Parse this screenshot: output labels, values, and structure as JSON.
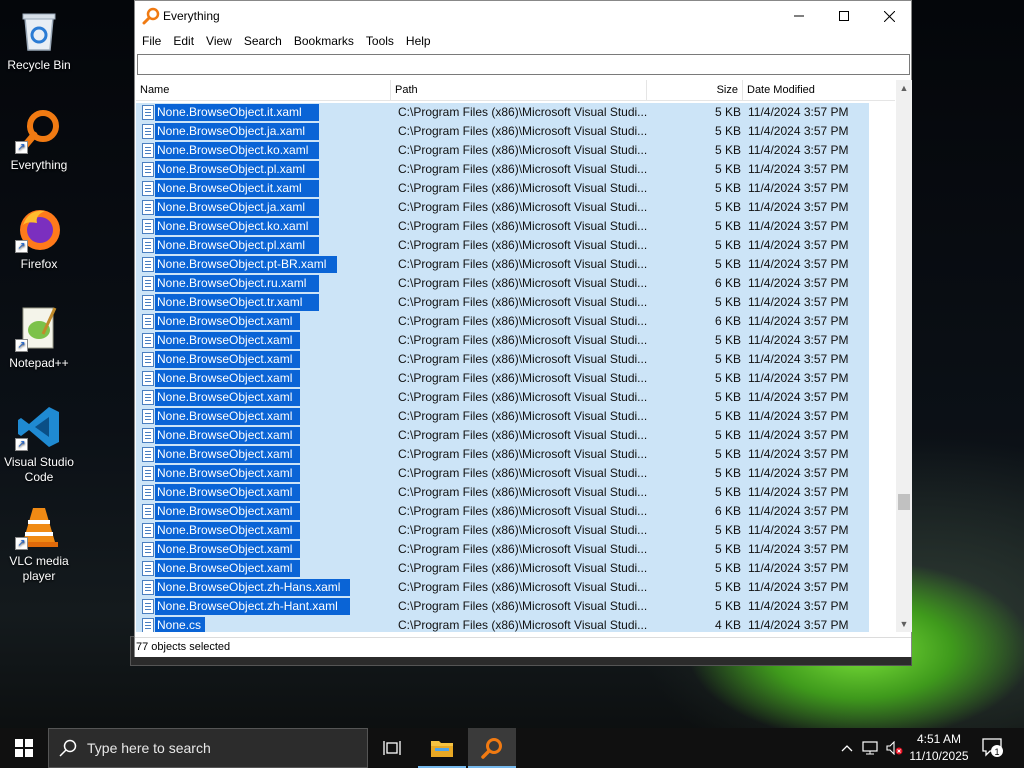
{
  "desktop": {
    "icons": [
      {
        "label": "Recycle Bin"
      },
      {
        "label": "Everything"
      },
      {
        "label": "Firefox"
      },
      {
        "label": "Notepad++"
      },
      {
        "label": "Visual Studio Code"
      },
      {
        "label": "VLC media player"
      }
    ]
  },
  "window": {
    "title": "Everything",
    "menu": [
      "File",
      "Edit",
      "View",
      "Search",
      "Bookmarks",
      "Tools",
      "Help"
    ],
    "search": {
      "value": "",
      "placeholder": ""
    },
    "columns": {
      "name": "Name",
      "path": "Path",
      "size": "Size",
      "date": "Date Modified"
    },
    "rows": [
      {
        "name": "None.BrowseObject.it.xaml",
        "path": "C:\\Program Files (x86)\\Microsoft Visual Studi...",
        "size": "5 KB",
        "date": "11/4/2024 3:57 PM"
      },
      {
        "name": "None.BrowseObject.ja.xaml",
        "path": "C:\\Program Files (x86)\\Microsoft Visual Studi...",
        "size": "5 KB",
        "date": "11/4/2024 3:57 PM"
      },
      {
        "name": "None.BrowseObject.ko.xaml",
        "path": "C:\\Program Files (x86)\\Microsoft Visual Studi...",
        "size": "5 KB",
        "date": "11/4/2024 3:57 PM"
      },
      {
        "name": "None.BrowseObject.pl.xaml",
        "path": "C:\\Program Files (x86)\\Microsoft Visual Studi...",
        "size": "5 KB",
        "date": "11/4/2024 3:57 PM"
      },
      {
        "name": "None.BrowseObject.it.xaml",
        "path": "C:\\Program Files (x86)\\Microsoft Visual Studi...",
        "size": "5 KB",
        "date": "11/4/2024 3:57 PM"
      },
      {
        "name": "None.BrowseObject.ja.xaml",
        "path": "C:\\Program Files (x86)\\Microsoft Visual Studi...",
        "size": "5 KB",
        "date": "11/4/2024 3:57 PM"
      },
      {
        "name": "None.BrowseObject.ko.xaml",
        "path": "C:\\Program Files (x86)\\Microsoft Visual Studi...",
        "size": "5 KB",
        "date": "11/4/2024 3:57 PM"
      },
      {
        "name": "None.BrowseObject.pl.xaml",
        "path": "C:\\Program Files (x86)\\Microsoft Visual Studi...",
        "size": "5 KB",
        "date": "11/4/2024 3:57 PM"
      },
      {
        "name": "None.BrowseObject.pt-BR.xaml",
        "path": "C:\\Program Files (x86)\\Microsoft Visual Studi...",
        "size": "5 KB",
        "date": "11/4/2024 3:57 PM"
      },
      {
        "name": "None.BrowseObject.ru.xaml",
        "path": "C:\\Program Files (x86)\\Microsoft Visual Studi...",
        "size": "6 KB",
        "date": "11/4/2024 3:57 PM"
      },
      {
        "name": "None.BrowseObject.tr.xaml",
        "path": "C:\\Program Files (x86)\\Microsoft Visual Studi...",
        "size": "5 KB",
        "date": "11/4/2024 3:57 PM"
      },
      {
        "name": "None.BrowseObject.xaml",
        "path": "C:\\Program Files (x86)\\Microsoft Visual Studi...",
        "size": "6 KB",
        "date": "11/4/2024 3:57 PM"
      },
      {
        "name": "None.BrowseObject.xaml",
        "path": "C:\\Program Files (x86)\\Microsoft Visual Studi...",
        "size": "5 KB",
        "date": "11/4/2024 3:57 PM"
      },
      {
        "name": "None.BrowseObject.xaml",
        "path": "C:\\Program Files (x86)\\Microsoft Visual Studi...",
        "size": "5 KB",
        "date": "11/4/2024 3:57 PM"
      },
      {
        "name": "None.BrowseObject.xaml",
        "path": "C:\\Program Files (x86)\\Microsoft Visual Studi...",
        "size": "5 KB",
        "date": "11/4/2024 3:57 PM"
      },
      {
        "name": "None.BrowseObject.xaml",
        "path": "C:\\Program Files (x86)\\Microsoft Visual Studi...",
        "size": "5 KB",
        "date": "11/4/2024 3:57 PM"
      },
      {
        "name": "None.BrowseObject.xaml",
        "path": "C:\\Program Files (x86)\\Microsoft Visual Studi...",
        "size": "5 KB",
        "date": "11/4/2024 3:57 PM"
      },
      {
        "name": "None.BrowseObject.xaml",
        "path": "C:\\Program Files (x86)\\Microsoft Visual Studi...",
        "size": "5 KB",
        "date": "11/4/2024 3:57 PM"
      },
      {
        "name": "None.BrowseObject.xaml",
        "path": "C:\\Program Files (x86)\\Microsoft Visual Studi...",
        "size": "5 KB",
        "date": "11/4/2024 3:57 PM"
      },
      {
        "name": "None.BrowseObject.xaml",
        "path": "C:\\Program Files (x86)\\Microsoft Visual Studi...",
        "size": "5 KB",
        "date": "11/4/2024 3:57 PM"
      },
      {
        "name": "None.BrowseObject.xaml",
        "path": "C:\\Program Files (x86)\\Microsoft Visual Studi...",
        "size": "5 KB",
        "date": "11/4/2024 3:57 PM"
      },
      {
        "name": "None.BrowseObject.xaml",
        "path": "C:\\Program Files (x86)\\Microsoft Visual Studi...",
        "size": "6 KB",
        "date": "11/4/2024 3:57 PM"
      },
      {
        "name": "None.BrowseObject.xaml",
        "path": "C:\\Program Files (x86)\\Microsoft Visual Studi...",
        "size": "5 KB",
        "date": "11/4/2024 3:57 PM"
      },
      {
        "name": "None.BrowseObject.xaml",
        "path": "C:\\Program Files (x86)\\Microsoft Visual Studi...",
        "size": "5 KB",
        "date": "11/4/2024 3:57 PM"
      },
      {
        "name": "None.BrowseObject.xaml",
        "path": "C:\\Program Files (x86)\\Microsoft Visual Studi...",
        "size": "5 KB",
        "date": "11/4/2024 3:57 PM"
      },
      {
        "name": "None.BrowseObject.zh-Hans.xaml",
        "path": "C:\\Program Files (x86)\\Microsoft Visual Studi...",
        "size": "5 KB",
        "date": "11/4/2024 3:57 PM"
      },
      {
        "name": "None.BrowseObject.zh-Hant.xaml",
        "path": "C:\\Program Files (x86)\\Microsoft Visual Studi...",
        "size": "5 KB",
        "date": "11/4/2024 3:57 PM"
      },
      {
        "name": "None.cs",
        "path": "C:\\Program Files (x86)\\Microsoft Visual Studi...",
        "size": "4 KB",
        "date": "11/4/2024 3:57 PM"
      }
    ],
    "status": "77 objects selected"
  },
  "taskbar": {
    "search_placeholder": "Type here to search",
    "time": "4:51 AM",
    "date": "11/10/2025",
    "notification_count": "1"
  },
  "colors": {
    "selection_row": "#cce4f7",
    "selection_name": "#0a64d6",
    "taskbar": "#101010"
  }
}
